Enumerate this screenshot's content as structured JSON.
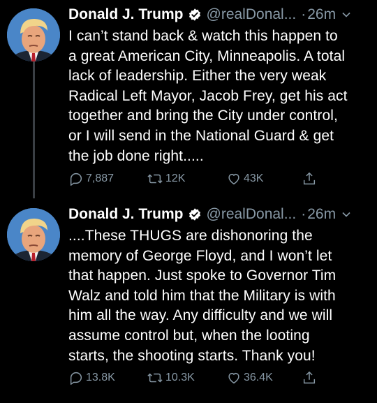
{
  "colors": {
    "background": "#000000",
    "text": "#ffffff",
    "muted": "#8899a6",
    "verified": "#ffffff",
    "thread_line": "#3a3f44"
  },
  "tweets": [
    {
      "author": {
        "name": "Donald J. Trump",
        "handle": "@realDonal...",
        "separator": "·",
        "time": "26m",
        "verified_icon": "verified-badge-icon"
      },
      "text": "I can’t stand back & watch this happen to\na great American City, Minneapolis. A total\nlack of leadership. Either the very weak\nRadical Left Mayor, Jacob Frey, get his act\ntogether and bring the City under control,\nor I will send in the National Guard & get\nthe job done right.....",
      "actions": {
        "replies": "7,887",
        "retweets": "12K",
        "likes": "43K"
      }
    },
    {
      "author": {
        "name": "Donald J. Trump",
        "handle": "@realDonal...",
        "separator": "·",
        "time": "26m",
        "verified_icon": "verified-badge-icon"
      },
      "text": "....These THUGS are dishonoring the\nmemory of George Floyd, and I won’t let\nthat happen. Just spoke to Governor Tim\nWalz and told him that the Military is with\nhim all the way. Any difficulty and we will\nassume control but, when the looting\nstarts, the shooting starts. Thank you!",
      "actions": {
        "replies": "13.8K",
        "retweets": "10.3K",
        "likes": "36.4K"
      }
    }
  ]
}
